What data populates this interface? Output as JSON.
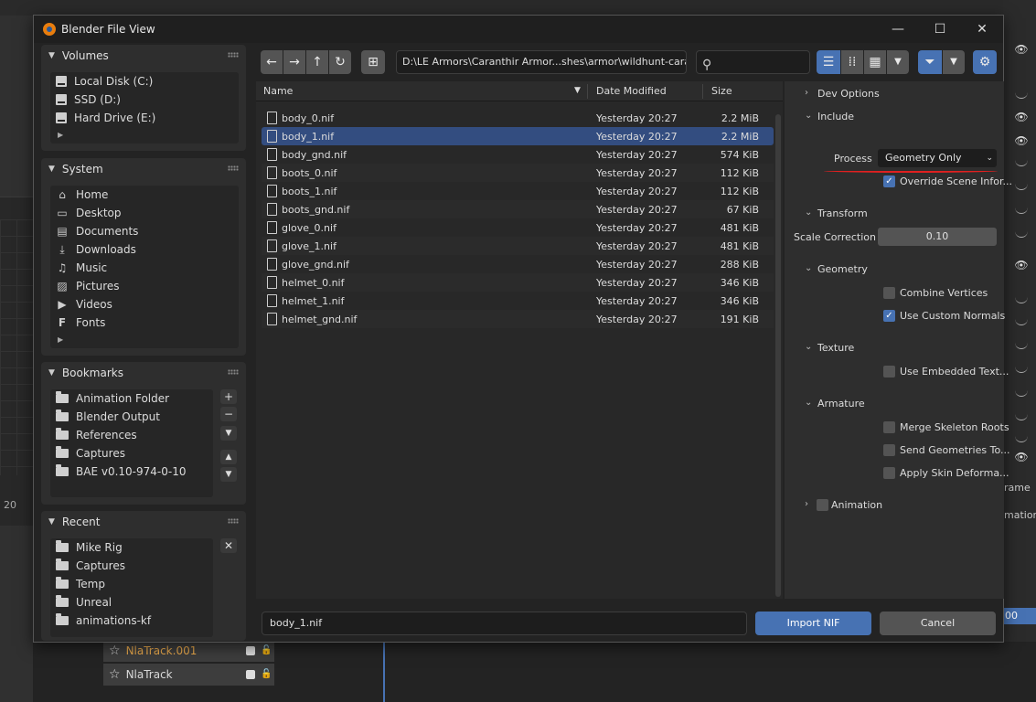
{
  "dialog": {
    "title": "Blender File View",
    "minimize_icon": "minimize-icon",
    "maximize_icon": "maximize-icon",
    "close_icon": "close-icon"
  },
  "background": {
    "nla_tracks": [
      "NlaTrack.001",
      "NlaTrack"
    ],
    "right_labels": [
      "rame",
      "mation",
      "00"
    ],
    "left_number": "20"
  },
  "sidebar": {
    "volumes": {
      "title": "Volumes",
      "items": [
        "Local Disk (C:)",
        "SSD (D:)",
        "Hard Drive (E:)"
      ]
    },
    "system": {
      "title": "System",
      "items": [
        {
          "label": "Home",
          "icon": "home-icon"
        },
        {
          "label": "Desktop",
          "icon": "desktop-icon"
        },
        {
          "label": "Documents",
          "icon": "documents-icon"
        },
        {
          "label": "Downloads",
          "icon": "downloads-icon"
        },
        {
          "label": "Music",
          "icon": "music-icon"
        },
        {
          "label": "Pictures",
          "icon": "pictures-icon"
        },
        {
          "label": "Videos",
          "icon": "videos-icon"
        },
        {
          "label": "Fonts",
          "icon": "fonts-icon"
        }
      ]
    },
    "bookmarks": {
      "title": "Bookmarks",
      "items": [
        "Animation Folder",
        "Blender Output",
        "References",
        "Captures",
        "BAE v0.10-974-0-10"
      ]
    },
    "recent": {
      "title": "Recent",
      "items": [
        "Mike Rig",
        "Captures",
        "Temp",
        "Unreal",
        "animations-kf"
      ]
    }
  },
  "toolbar": {
    "path": "D:\\LE Armors\\Caranthir Armor...shes\\armor\\wildhunt-caranthir\\",
    "search_placeholder": ""
  },
  "file_list": {
    "columns": {
      "name": "Name",
      "date": "Date Modified",
      "size": "Size"
    },
    "rows": [
      {
        "name": "body_0.nif",
        "date": "Yesterday 20:27",
        "size": "2.2 MiB"
      },
      {
        "name": "body_1.nif",
        "date": "Yesterday 20:27",
        "size": "2.2 MiB",
        "selected": true
      },
      {
        "name": "body_gnd.nif",
        "date": "Yesterday 20:27",
        "size": "574 KiB"
      },
      {
        "name": "boots_0.nif",
        "date": "Yesterday 20:27",
        "size": "112 KiB"
      },
      {
        "name": "boots_1.nif",
        "date": "Yesterday 20:27",
        "size": "112 KiB"
      },
      {
        "name": "boots_gnd.nif",
        "date": "Yesterday 20:27",
        "size": "67 KiB"
      },
      {
        "name": "glove_0.nif",
        "date": "Yesterday 20:27",
        "size": "481 KiB"
      },
      {
        "name": "glove_1.nif",
        "date": "Yesterday 20:27",
        "size": "481 KiB"
      },
      {
        "name": "glove_gnd.nif",
        "date": "Yesterday 20:27",
        "size": "288 KiB"
      },
      {
        "name": "helmet_0.nif",
        "date": "Yesterday 20:27",
        "size": "346 KiB"
      },
      {
        "name": "helmet_1.nif",
        "date": "Yesterday 20:27",
        "size": "346 KiB"
      },
      {
        "name": "helmet_gnd.nif",
        "date": "Yesterday 20:27",
        "size": "191 KiB"
      }
    ]
  },
  "filename": "body_1.nif",
  "buttons": {
    "import": "Import NIF",
    "cancel": "Cancel"
  },
  "options": {
    "dev_options": "Dev Options",
    "include": "Include",
    "process_label": "Process",
    "process_value": "Geometry Only",
    "override": "Override Scene Infor...",
    "transform": "Transform",
    "scale_label": "Scale Correction",
    "scale_value": "0.10",
    "geometry": "Geometry",
    "combine_vertices": "Combine Vertices",
    "use_custom_normals": "Use Custom Normals",
    "texture": "Texture",
    "use_embedded": "Use Embedded Text...",
    "armature": "Armature",
    "merge_skeleton": "Merge Skeleton Roots",
    "send_geometries": "Send Geometries To...",
    "apply_skin": "Apply Skin Deforma...",
    "animation": "Animation"
  },
  "colors": {
    "accent": "#4772b3",
    "selection": "#334d80",
    "highlight_line": "#e02020"
  }
}
